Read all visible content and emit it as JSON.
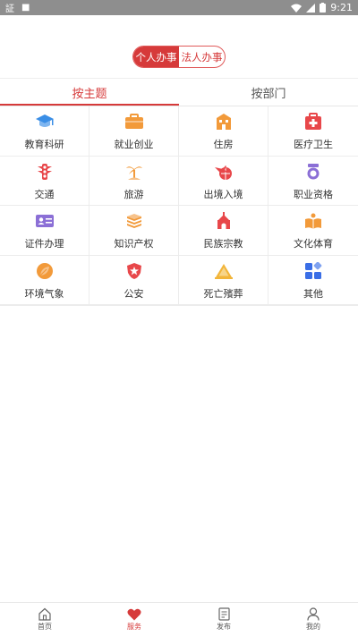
{
  "status_bar": {
    "left_icons": [
      "notification-icon-1",
      "notification-icon-2"
    ],
    "left_text_1": "証",
    "left_text_2": "■",
    "time": "9:21"
  },
  "toggle": {
    "personal_label": "个人办事",
    "corporate_label": "法人办事",
    "active": "personal"
  },
  "tabs": [
    {
      "label": "按主题",
      "active": true
    },
    {
      "label": "按部门",
      "active": false
    }
  ],
  "categories": [
    {
      "label": "教育科研",
      "icon": "graduation-cap-icon",
      "color": "#3a8ee6"
    },
    {
      "label": "就业创业",
      "icon": "briefcase-icon",
      "color": "#f29a3a"
    },
    {
      "label": "住房",
      "icon": "building-icon",
      "color": "#f29a3a"
    },
    {
      "label": "医疗卫生",
      "icon": "medical-kit-icon",
      "color": "#e8474a"
    },
    {
      "label": "交通",
      "icon": "traffic-light-icon",
      "color": "#e8474a"
    },
    {
      "label": "旅游",
      "icon": "palm-tree-icon",
      "color": "#f29a3a"
    },
    {
      "label": "出境入境",
      "icon": "plane-globe-icon",
      "color": "#e8474a"
    },
    {
      "label": "职业资格",
      "icon": "medal-icon",
      "color": "#8b6fd6"
    },
    {
      "label": "证件办理",
      "icon": "id-card-icon",
      "color": "#8b6fd6"
    },
    {
      "label": "知识产权",
      "icon": "book-stack-icon",
      "color": "#f29a3a"
    },
    {
      "label": "民族宗教",
      "icon": "temple-icon",
      "color": "#e8474a"
    },
    {
      "label": "文化体育",
      "icon": "open-book-icon",
      "color": "#f29a3a"
    },
    {
      "label": "环境气象",
      "icon": "leaf-icon",
      "color": "#f29a3a"
    },
    {
      "label": "公安",
      "icon": "police-badge-icon",
      "color": "#e8474a"
    },
    {
      "label": "死亡殯葬",
      "icon": "warning-triangle-icon",
      "color": "#f2b53a"
    },
    {
      "label": "其他",
      "icon": "apps-grid-icon",
      "color": "#3a6ee6"
    }
  ],
  "bottom_nav": [
    {
      "label": "首页",
      "icon": "home-icon",
      "active": false
    },
    {
      "label": "服务",
      "icon": "heart-icon",
      "active": true
    },
    {
      "label": "发布",
      "icon": "document-icon",
      "active": false
    },
    {
      "label": "我的",
      "icon": "user-icon",
      "active": false
    }
  ],
  "colors": {
    "accent": "#d63a3a",
    "divider": "#ececec",
    "status_bar": "#8e8e8e"
  }
}
